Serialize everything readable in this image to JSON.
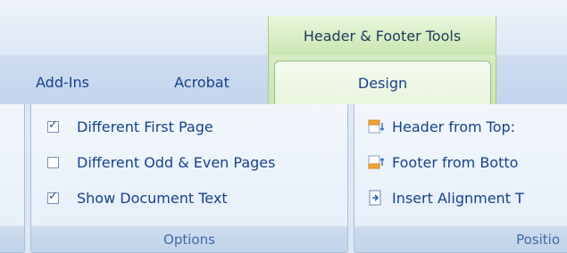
{
  "contextual_tab_group": {
    "label": "Header & Footer Tools"
  },
  "tabs": [
    {
      "label": "Add-Ins"
    },
    {
      "label": "Acrobat"
    },
    {
      "label": "Design",
      "active": true
    }
  ],
  "options_group": {
    "title": "Options",
    "items": [
      {
        "label": "Different First Page",
        "checked": true
      },
      {
        "label": "Different Odd & Even Pages",
        "checked": false
      },
      {
        "label": "Show Document Text",
        "checked": true
      }
    ]
  },
  "position_group": {
    "title": "Positio",
    "items": [
      {
        "label": "Header from Top:",
        "icon": "header-position-icon"
      },
      {
        "label": "Footer from Botto",
        "icon": "footer-position-icon"
      },
      {
        "label": "Insert Alignment T",
        "icon": "alignment-tab-icon"
      }
    ]
  },
  "colors": {
    "context_green": "#cbe5b6",
    "text_blue": "#15428b"
  }
}
